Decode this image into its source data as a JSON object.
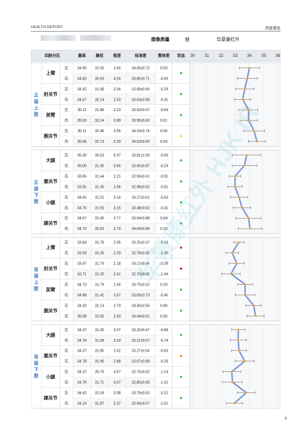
{
  "header": {
    "title": "HEALTH REPORT",
    "dept": "西医报告"
  },
  "info": {
    "quality_label": "图像质量",
    "quality_value": "分",
    "brand": "华景康红外"
  },
  "table": {
    "col_region": "四肢分区",
    "col_max": "最高",
    "col_min": "最低",
    "col_range": "极差",
    "col_std": "标准差",
    "col_diff": "整体差",
    "col_status": "状态"
  },
  "groups": [
    {
      "label": "正面上肢",
      "parts": [
        {
          "name": "上臂",
          "rows": [
            {
              "side": "左",
              "max": "34.95",
              "min": "31.50",
              "range": "3.45",
              "std": "34.00±0.72",
              "diff": "0.03",
              "status": "green"
            },
            {
              "side": "右",
              "max": "34.83",
              "min": "30.59",
              "range": "4.24",
              "std": "33.85±0.71",
              "diff": "-0.09",
              "status": "none"
            }
          ]
        },
        {
          "name": "肘关节",
          "rows": [
            {
              "side": "左",
              "max": "34.92",
              "min": "31.88",
              "range": "3.04",
              "std": "33.68±0.66",
              "diff": "-0.29",
              "status": "green"
            },
            {
              "side": "右",
              "max": "34.67",
              "min": "32.14",
              "range": "2.53",
              "std": "33.53±0.58",
              "diff": "-0.41",
              "status": "none"
            }
          ]
        },
        {
          "name": "前臂",
          "rows": [
            {
              "side": "左",
              "max": "35.11",
              "min": "31.88",
              "range": "3.23",
              "std": "33.93±0.67",
              "diff": "-0.04",
              "status": "green"
            },
            {
              "side": "右",
              "max": "35.03",
              "min": "32.14",
              "range": "2.89",
              "std": "33.95±0.62",
              "diff": "0.01",
              "status": "none"
            }
          ]
        },
        {
          "name": "腕关节",
          "rows": [
            {
              "side": "左",
              "max": "35.11",
              "min": "32.46",
              "range": "2.65",
              "std": "34.33±0.74",
              "diff": "0.36",
              "status": "yellow"
            },
            {
              "side": "右",
              "max": "35.06",
              "min": "32.73",
              "range": "2.33",
              "std": "34.53±0.60",
              "diff": "0.59",
              "status": "none"
            }
          ]
        }
      ]
    },
    {
      "label": "正面下肢",
      "parts": [
        {
          "name": "大腿",
          "rows": [
            {
              "side": "左",
              "max": "35.30",
              "min": "30.23",
              "range": "5.07",
              "std": "33.81±1.00",
              "diff": "-0.09",
              "status": "green"
            },
            {
              "side": "右",
              "max": "35.00",
              "min": "31.35",
              "range": "3.65",
              "std": "33.65±0.87",
              "diff": "-0.24",
              "status": "none"
            }
          ]
        },
        {
          "name": "膝关节",
          "rows": [
            {
              "side": "左",
              "max": "33.65",
              "min": "31.44",
              "range": "2.21",
              "std": "32.99±0.41",
              "diff": "-0.91",
              "status": "green"
            },
            {
              "side": "右",
              "max": "33.91",
              "min": "31.35",
              "range": "2.56",
              "std": "32.98±0.52",
              "diff": "-0.91",
              "status": "none"
            }
          ]
        },
        {
          "name": "小腿",
          "rows": [
            {
              "side": "左",
              "max": "34.65",
              "min": "31.51",
              "range": "3.14",
              "std": "33.27±0.61",
              "diff": "-0.63",
              "status": "green"
            },
            {
              "side": "右",
              "max": "34.70",
              "min": "31.55",
              "range": "3.15",
              "std": "33.48±0.62",
              "diff": "-0.41",
              "status": "none"
            }
          ]
        },
        {
          "name": "踝关节",
          "rows": [
            {
              "side": "左",
              "max": "34.67",
              "min": "31.90",
              "range": "2.77",
              "std": "33.94±0.88",
              "diff": "0.04",
              "status": "green"
            },
            {
              "side": "右",
              "max": "34.72",
              "min": "32.02",
              "range": "2.70",
              "std": "34.04±0.84",
              "diff": "0.15",
              "status": "none"
            }
          ]
        }
      ]
    },
    {
      "label": "背面上肢",
      "parts": [
        {
          "name": "上臂",
          "rows": [
            {
              "side": "左",
              "max": "33.84",
              "min": "31.79",
              "range": "2.05",
              "std": "33.25±0.37",
              "diff": "-0.16",
              "status": "red"
            },
            {
              "side": "右",
              "max": "33.59",
              "min": "31.30",
              "range": "2.29",
              "std": "32.78±0.45",
              "diff": "-1.36",
              "status": "none"
            }
          ]
        },
        {
          "name": "肘关节",
          "rows": [
            {
              "side": "左",
              "max": "33.97",
              "min": "31.79",
              "range": "2.18",
              "std": "33.12±0.54",
              "diff": "-0.29",
              "status": "red"
            },
            {
              "side": "右",
              "max": "33.71",
              "min": "31.30",
              "range": "2.41",
              "std": "32.70±0.65",
              "diff": "-1.44",
              "status": "none"
            }
          ]
        },
        {
          "name": "前臂",
          "rows": [
            {
              "side": "左",
              "max": "34.73",
              "min": "31.79",
              "range": "2.94",
              "std": "33.70±0.52",
              "diff": "0.29",
              "status": "green"
            },
            {
              "side": "右",
              "max": "34.98",
              "min": "31.41",
              "range": "3.57",
              "std": "33.69±0.70",
              "diff": "-0.45",
              "status": "none"
            }
          ]
        },
        {
          "name": "腕关节",
          "rows": [
            {
              "side": "左",
              "max": "34.93",
              "min": "32.14",
              "range": "2.79",
              "std": "34.30±0.55",
              "diff": "0.89",
              "status": "green"
            },
            {
              "side": "右",
              "max": "35.08",
              "min": "32.65",
              "range": "2.43",
              "std": "34.44±0.61",
              "diff": "0.30",
              "status": "none"
            }
          ]
        }
      ]
    },
    {
      "label": "背面下肢",
      "parts": [
        {
          "name": "大腿",
          "rows": [
            {
              "side": "左",
              "max": "34.37",
              "min": "31.30",
              "range": "3.07",
              "std": "33.22±0.47",
              "diff": "-0.68",
              "status": "green"
            },
            {
              "side": "右",
              "max": "34.78",
              "min": "31.58",
              "range": "3.20",
              "std": "33.21±0.57",
              "diff": "-0.74",
              "status": "none"
            }
          ]
        },
        {
          "name": "膝关节",
          "rows": [
            {
              "side": "左",
              "max": "34.37",
              "min": "31.85",
              "range": "2.52",
              "std": "33.27±0.54",
              "diff": "-0.63",
              "status": "orange"
            },
            {
              "side": "右",
              "max": "34.78",
              "min": "31.90",
              "range": "2.88",
              "std": "33.67±0.68",
              "diff": "-0.28",
              "status": "none"
            }
          ]
        },
        {
          "name": "小腿",
          "rows": [
            {
              "side": "左",
              "max": "34.37",
              "min": "30.70",
              "range": "3.67",
              "std": "32.76±0.62",
              "diff": "-1.14",
              "status": "green"
            },
            {
              "side": "右",
              "max": "34.78",
              "min": "31.71",
              "range": "3.07",
              "std": "32.80±0.68",
              "diff": "-1.15",
              "status": "none"
            }
          ]
        },
        {
          "name": "踝关节",
          "rows": [
            {
              "side": "左",
              "max": "34.62",
              "min": "31.54",
              "range": "3.08",
              "std": "33.78±0.63",
              "diff": "-0.12",
              "status": "green"
            },
            {
              "side": "右",
              "max": "34.24",
              "min": "31.87",
              "range": "2.37",
              "std": "32.94±0.57",
              "diff": "-1.01",
              "status": "none"
            }
          ]
        }
      ]
    }
  ],
  "chart_data": {
    "type": "line",
    "x_ticks": [
      "30",
      "31",
      "32",
      "33",
      "34",
      "35",
      "36"
    ],
    "xlim": [
      30,
      36
    ],
    "series": [
      {
        "values": [
          34.0,
          33.85,
          33.68,
          33.53,
          33.93,
          33.95,
          34.33,
          34.53,
          33.81,
          33.65,
          32.99,
          32.98,
          33.27,
          33.48,
          33.94,
          34.04,
          33.25,
          32.78,
          33.12,
          32.7,
          33.7,
          33.69,
          34.3,
          34.44,
          33.22,
          33.21,
          33.27,
          33.67,
          32.76,
          32.8,
          33.78,
          32.94
        ]
      }
    ],
    "colors": {
      "line_a": "#7b68c8",
      "line_b": "#7fb4dc",
      "point": "#f0a830",
      "error": "#555555"
    },
    "status_colors": {
      "green": "#2ecc40",
      "yellow": "#e8e030",
      "red": "#d62020",
      "orange": "#f08c20"
    }
  },
  "footer": {
    "page": "4"
  }
}
